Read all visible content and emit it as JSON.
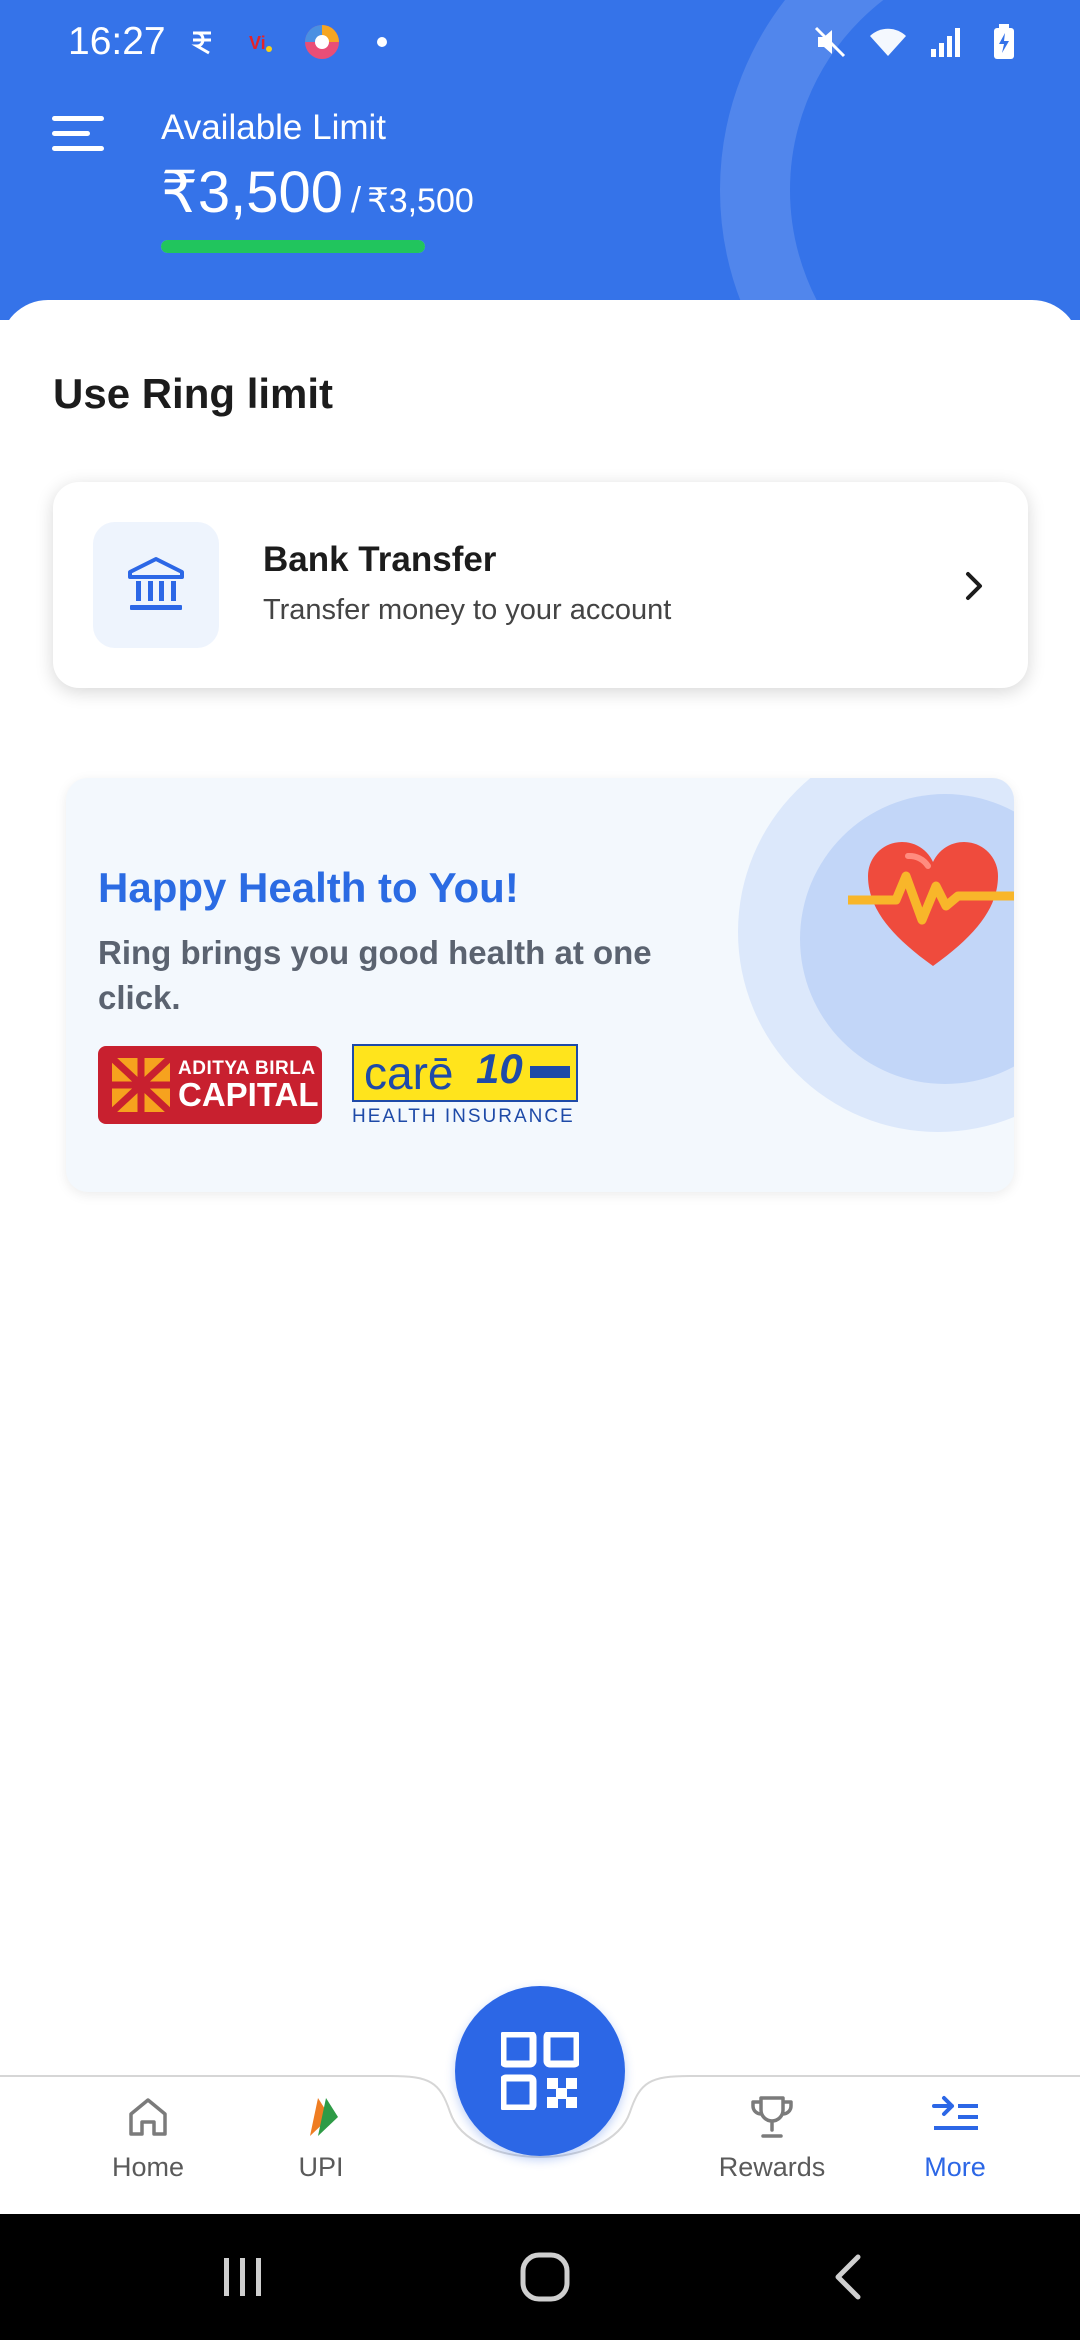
{
  "status_bar": {
    "time": "16:27",
    "left_icons": [
      "rupee-notification-icon",
      "vi-notification-icon",
      "browser-notification-icon",
      "dot-icon"
    ],
    "right_icons": [
      "mute-icon",
      "wifi-icon",
      "signal-icon",
      "battery-icon"
    ]
  },
  "header": {
    "available_label": "Available Limit",
    "amount": "₹3,500",
    "separator": "/",
    "total": "₹3,500",
    "limit_used_fraction": 1.0,
    "bg_color": "#3573e9",
    "bar_color": "#21c55d"
  },
  "section": {
    "title": "Use Ring limit"
  },
  "bank_transfer": {
    "title": "Bank Transfer",
    "subtitle": "Transfer money to your account",
    "icon": "bank-icon"
  },
  "promo": {
    "title": "Happy Health to You!",
    "subtitle": "Ring brings you good health at one click.",
    "partner1_line1": "ADITYA BIRLA",
    "partner1_line2": "CAPITAL",
    "partner2_word": "carē",
    "partner2_years": "10",
    "partner2_tag": "HEALTH INSURANCE",
    "accent_color": "#2b6be3"
  },
  "bottom_nav": {
    "items": [
      {
        "label": "Home",
        "icon": "home-icon",
        "active": false
      },
      {
        "label": "UPI",
        "icon": "upi-icon",
        "active": false
      },
      {
        "label": "Rewards",
        "icon": "trophy-icon",
        "active": false
      },
      {
        "label": "More",
        "icon": "more-icon",
        "active": true
      }
    ],
    "center_button": "qr-scan-icon",
    "active_color": "#2c67e6"
  },
  "system_nav": [
    "recents-icon",
    "home-circle-icon",
    "back-icon"
  ]
}
